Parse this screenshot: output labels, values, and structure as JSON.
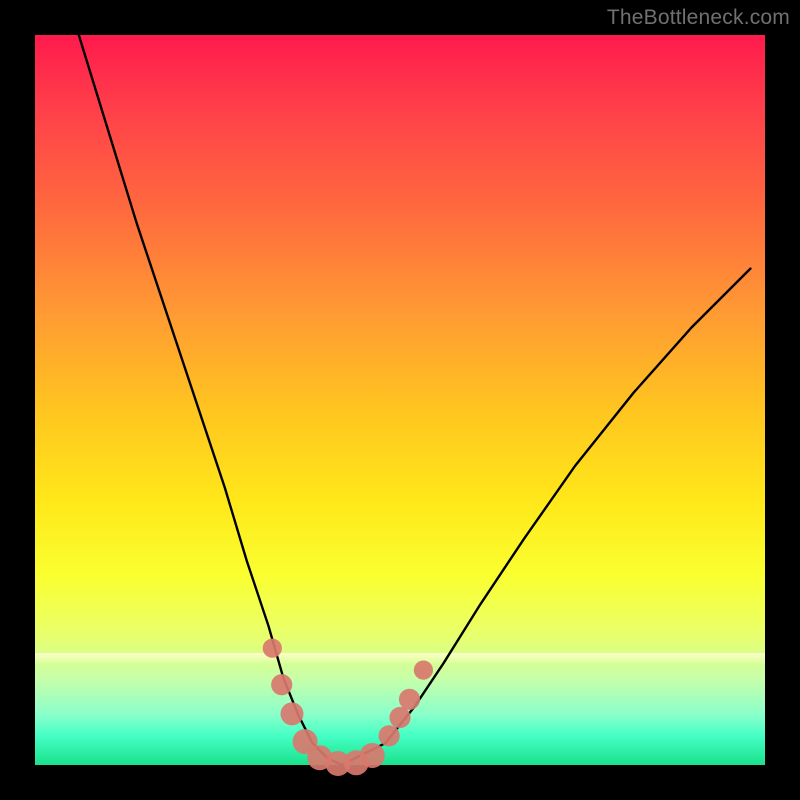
{
  "watermark": "TheBottleneck.com",
  "chart_data": {
    "type": "line",
    "title": "",
    "xlabel": "",
    "ylabel": "",
    "xlim": [
      0,
      100
    ],
    "ylim": [
      0,
      100
    ],
    "series": [
      {
        "name": "bottleneck-curve",
        "x": [
          6,
          10,
          14,
          18,
          22,
          26,
          29,
          32,
          34,
          36,
          38,
          40,
          42,
          44,
          48,
          52,
          56,
          61,
          67,
          74,
          82,
          90,
          98
        ],
        "y": [
          100,
          87,
          74,
          62,
          50,
          38,
          28,
          19,
          12,
          7,
          3,
          1,
          0,
          1,
          3,
          8,
          14,
          22,
          31,
          41,
          51,
          60,
          68
        ]
      }
    ],
    "markers": {
      "name": "highlighted-points",
      "color": "#d9786e",
      "points": [
        {
          "x": 32.5,
          "y": 16,
          "r": 2.0
        },
        {
          "x": 33.8,
          "y": 11,
          "r": 2.2
        },
        {
          "x": 35.2,
          "y": 7,
          "r": 2.4
        },
        {
          "x": 37.0,
          "y": 3.2,
          "r": 2.6
        },
        {
          "x": 39.0,
          "y": 1.0,
          "r": 2.6
        },
        {
          "x": 41.5,
          "y": 0.2,
          "r": 2.6
        },
        {
          "x": 44.0,
          "y": 0.3,
          "r": 2.6
        },
        {
          "x": 46.2,
          "y": 1.3,
          "r": 2.6
        },
        {
          "x": 48.5,
          "y": 4.0,
          "r": 2.2
        },
        {
          "x": 50.0,
          "y": 6.5,
          "r": 2.2
        },
        {
          "x": 51.3,
          "y": 9.0,
          "r": 2.2
        },
        {
          "x": 53.2,
          "y": 13.0,
          "r": 2.0
        }
      ]
    },
    "gradient_stops": [
      {
        "pos": 0,
        "color": "#ff1a4d"
      },
      {
        "pos": 24,
        "color": "#ff6a3e"
      },
      {
        "pos": 52,
        "color": "#ffc71f"
      },
      {
        "pos": 74,
        "color": "#faff30"
      },
      {
        "pos": 93,
        "color": "#8bffca"
      },
      {
        "pos": 100,
        "color": "#19e28c"
      }
    ]
  }
}
